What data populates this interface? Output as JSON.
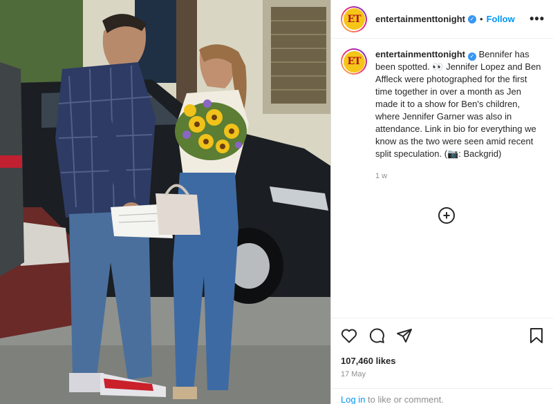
{
  "post": {
    "account": "entertainmenttonight",
    "avatar_text": "ET",
    "follow_label": "Follow",
    "separator": "•",
    "more_label": "•••",
    "caption": "Bennifer has been spotted. 👀 Jennifer Lopez and Ben Affleck were photographed for the first time together in over a month as Jen made it to a show for Ben's children, where Jennifer Garner was also in attendance. Link in bio for everything we know as the two were seen amid recent split speculation. (📷: Backgrid)",
    "time_ago": "1 w",
    "likes": "107,460 likes",
    "date": "17 May",
    "login_link": "Log in",
    "login_rest": " to like or comment."
  },
  "icons": {
    "verified": "verified-badge-icon",
    "more": "more-options-icon",
    "add_comment": "plus-circle-icon",
    "like": "heart-icon",
    "comment": "comment-bubble-icon",
    "share": "paper-plane-icon",
    "save": "bookmark-icon"
  },
  "colors": {
    "follow": "#0095f6",
    "verified": "#3897f0",
    "text": "#262626",
    "muted": "#8e8e8e",
    "avatar_bg": "#f5c518",
    "avatar_text": "#b0121b"
  }
}
